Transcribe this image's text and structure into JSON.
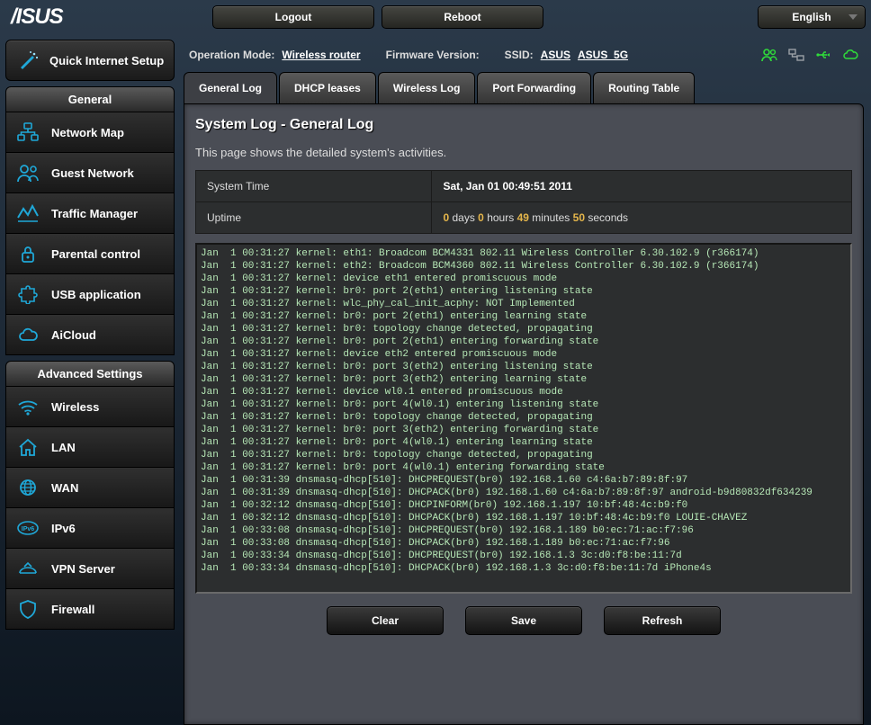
{
  "header": {
    "logo": "/ISUS",
    "logout": "Logout",
    "reboot": "Reboot",
    "language": "English"
  },
  "info": {
    "op_mode_label": "Operation Mode:",
    "op_mode_value": "Wireless router",
    "fw_label": "Firmware Version:",
    "ssid_label": "SSID:",
    "ssid1": "ASUS",
    "ssid2": "ASUS_5G"
  },
  "qis": {
    "label": "Quick Internet Setup"
  },
  "sidebar": {
    "general_header": "General",
    "general": [
      {
        "label": "Network Map",
        "icon": "network"
      },
      {
        "label": "Guest Network",
        "icon": "guest"
      },
      {
        "label": "Traffic Manager",
        "icon": "traffic"
      },
      {
        "label": "Parental control",
        "icon": "lock"
      },
      {
        "label": "USB application",
        "icon": "puzzle"
      },
      {
        "label": "AiCloud",
        "icon": "cloud"
      }
    ],
    "advanced_header": "Advanced Settings",
    "advanced": [
      {
        "label": "Wireless",
        "icon": "wifi"
      },
      {
        "label": "LAN",
        "icon": "house"
      },
      {
        "label": "WAN",
        "icon": "globe"
      },
      {
        "label": "IPv6",
        "icon": "ipv6"
      },
      {
        "label": "VPN Server",
        "icon": "vpn"
      },
      {
        "label": "Firewall",
        "icon": "shield"
      }
    ]
  },
  "tabs": [
    {
      "label": "General Log",
      "active": true
    },
    {
      "label": "DHCP leases",
      "active": false
    },
    {
      "label": "Wireless Log",
      "active": false
    },
    {
      "label": "Port Forwarding",
      "active": false
    },
    {
      "label": "Routing Table",
      "active": false
    }
  ],
  "panel": {
    "title": "System Log - General Log",
    "desc": "This page shows the detailed system's activities.",
    "system_time_label": "System Time",
    "system_time_value": "Sat, Jan 01  00:49:51  2011",
    "uptime_label": "Uptime",
    "uptime": {
      "d": "0",
      "h": "0",
      "m": "49",
      "s": "50",
      "dl": "days",
      "hl": "hours",
      "ml": "minutes",
      "sl": "seconds"
    }
  },
  "buttons": {
    "clear": "Clear",
    "save": "Save",
    "refresh": "Refresh"
  },
  "log": "Jan  1 00:31:27 kernel: eth1: Broadcom BCM4331 802.11 Wireless Controller 6.30.102.9 (r366174)\nJan  1 00:31:27 kernel: eth2: Broadcom BCM4360 802.11 Wireless Controller 6.30.102.9 (r366174)\nJan  1 00:31:27 kernel: device eth1 entered promiscuous mode\nJan  1 00:31:27 kernel: br0: port 2(eth1) entering listening state\nJan  1 00:31:27 kernel: wlc_phy_cal_init_acphy: NOT Implemented\nJan  1 00:31:27 kernel: br0: port 2(eth1) entering learning state\nJan  1 00:31:27 kernel: br0: topology change detected, propagating\nJan  1 00:31:27 kernel: br0: port 2(eth1) entering forwarding state\nJan  1 00:31:27 kernel: device eth2 entered promiscuous mode\nJan  1 00:31:27 kernel: br0: port 3(eth2) entering listening state\nJan  1 00:31:27 kernel: br0: port 3(eth2) entering learning state\nJan  1 00:31:27 kernel: device wl0.1 entered promiscuous mode\nJan  1 00:31:27 kernel: br0: port 4(wl0.1) entering listening state\nJan  1 00:31:27 kernel: br0: topology change detected, propagating\nJan  1 00:31:27 kernel: br0: port 3(eth2) entering forwarding state\nJan  1 00:31:27 kernel: br0: port 4(wl0.1) entering learning state\nJan  1 00:31:27 kernel: br0: topology change detected, propagating\nJan  1 00:31:27 kernel: br0: port 4(wl0.1) entering forwarding state\nJan  1 00:31:39 dnsmasq-dhcp[510]: DHCPREQUEST(br0) 192.168.1.60 c4:6a:b7:89:8f:97\nJan  1 00:31:39 dnsmasq-dhcp[510]: DHCPACK(br0) 192.168.1.60 c4:6a:b7:89:8f:97 android-b9d80832df634239\nJan  1 00:32:12 dnsmasq-dhcp[510]: DHCPINFORM(br0) 192.168.1.197 10:bf:48:4c:b9:f0\nJan  1 00:32:12 dnsmasq-dhcp[510]: DHCPACK(br0) 192.168.1.197 10:bf:48:4c:b9:f0 LOUIE-CHAVEZ\nJan  1 00:33:08 dnsmasq-dhcp[510]: DHCPREQUEST(br0) 192.168.1.189 b0:ec:71:ac:f7:96\nJan  1 00:33:08 dnsmasq-dhcp[510]: DHCPACK(br0) 192.168.1.189 b0:ec:71:ac:f7:96\nJan  1 00:33:34 dnsmasq-dhcp[510]: DHCPREQUEST(br0) 192.168.1.3 3c:d0:f8:be:11:7d\nJan  1 00:33:34 dnsmasq-dhcp[510]: DHCPACK(br0) 192.168.1.3 3c:d0:f8:be:11:7d iPhone4s"
}
